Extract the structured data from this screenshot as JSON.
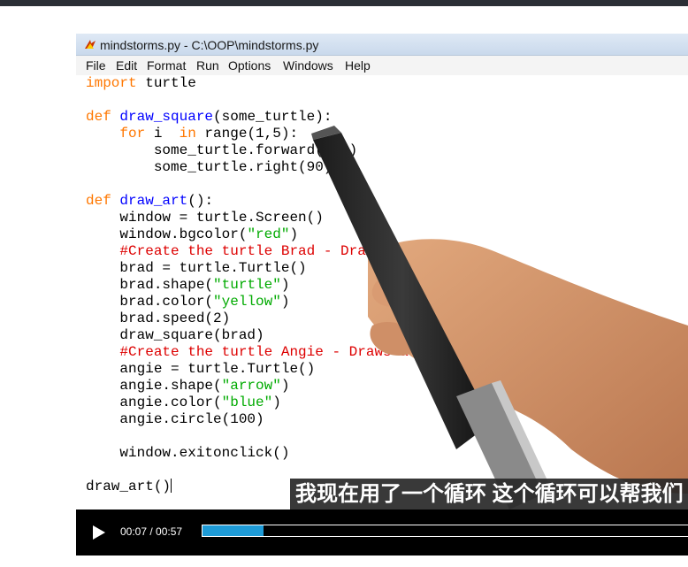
{
  "window": {
    "title": "mindstorms.py - C:\\OOP\\mindstorms.py"
  },
  "menu": [
    "File",
    "Edit",
    "Format",
    "Run",
    "Options",
    "Windows",
    "Help"
  ],
  "code": {
    "l1_kw": "import",
    "l1_rest": " turtle",
    "l2_kw": "def",
    "l2_name": " draw_square",
    "l2_rest": "(some_turtle):",
    "l3_ind": "    ",
    "l3_kw1": "for",
    "l3_mid": " i  ",
    "l3_kw2": "in",
    "l3_rest": " range(1,5):",
    "l4": "        some_turtle.forward(100)",
    "l5": "        some_turtle.right(90)",
    "l6_kw": "def",
    "l6_name": " draw_art",
    "l6_rest": "():",
    "l7": "    window = turtle.Screen()",
    "l8_a": "    window.bgcolor(",
    "l8_s": "\"red\"",
    "l8_b": ")",
    "l9": "    #Create the turtle Brad - Draws a sqaure",
    "l10": "    brad = turtle.Turtle()",
    "l11_a": "    brad.shape(",
    "l11_s": "\"turtle\"",
    "l11_b": ")",
    "l12_a": "    brad.color(",
    "l12_s": "\"yellow\"",
    "l12_b": ")",
    "l13": "    brad.speed(2)",
    "l14": "    draw_square(brad)",
    "l15": "    #Create the turtle Angie - Draws a circle",
    "l16": "    angie = turtle.Turtle()",
    "l17_a": "    angie.shape(",
    "l17_s": "\"arrow\"",
    "l17_b": ")",
    "l18_a": "    angie.color(",
    "l18_s": "\"blue\"",
    "l18_b": ")",
    "l19": "    angie.circle(100)",
    "l20": "    window.exitonclick()",
    "l21": "draw_art()"
  },
  "subtitle": "我现在用了一个循环 这个循环可以帮我们",
  "player": {
    "time": "00:07 / 00:57",
    "progress_fraction": 0.123
  },
  "colors": {
    "progress": "#1e9bd7",
    "keyword": "#ff7700",
    "definition": "#0000ff",
    "string": "#00aa00",
    "comment": "#dd0000"
  }
}
